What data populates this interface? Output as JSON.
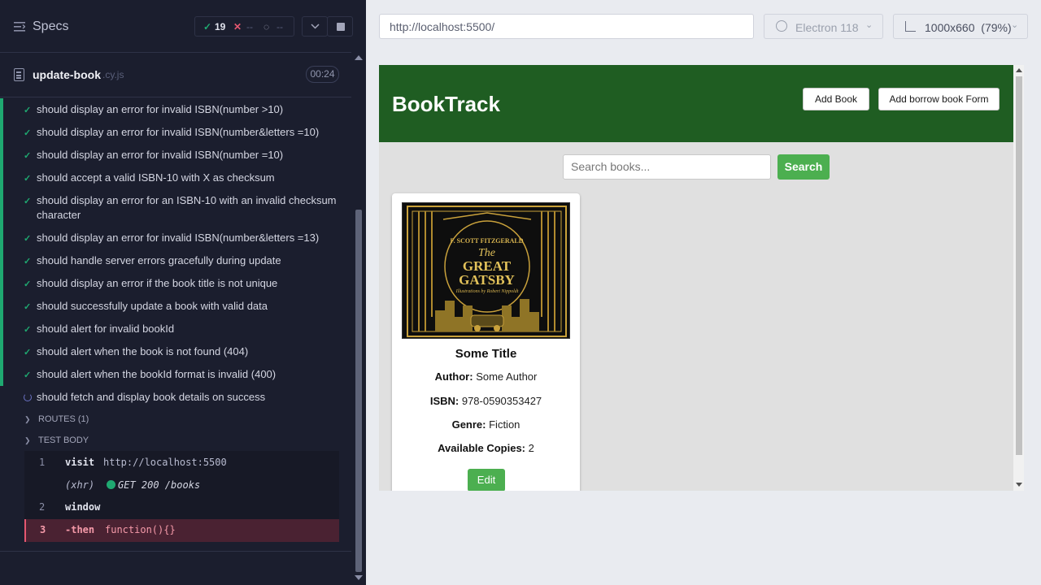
{
  "runner": {
    "specs_label": "Specs",
    "stats": {
      "passed": "19",
      "failed": "--",
      "pending": "--"
    },
    "spec": {
      "name": "update-book",
      "ext": ".cy.js",
      "duration": "00:24"
    },
    "tests": [
      "should display an error for invalid ISBN(number >10)",
      "should display an error for invalid ISBN(number&letters =10)",
      "should display an error for invalid ISBN(number =10)",
      "should accept a valid ISBN-10 with X as checksum",
      "should display an error for an ISBN-10 with an invalid checksum character",
      "should display an error for invalid ISBN(number&letters =13)",
      "should handle server errors gracefully during update",
      "should display an error if the book title is not unique",
      "should successfully update a book with valid data",
      "should alert for invalid bookId",
      "should alert when the book is not found (404)",
      "should alert when the bookId format is invalid (400)"
    ],
    "running_test": "should fetch and display book details on success",
    "routes_label": "ROUTES (1)",
    "body_label": "TEST BODY",
    "commands": {
      "c1": {
        "num": "1",
        "name": "visit",
        "msg": "http://localhost:5500"
      },
      "xhr": {
        "tag": "(xhr)",
        "msg": "GET 200 /books"
      },
      "c2": {
        "num": "2",
        "name": "window"
      },
      "c3": {
        "num": "3",
        "name": "-then",
        "msg": "function(){}"
      }
    },
    "colors": {
      "pass": "#1fa971",
      "fail": "#e45770",
      "bg": "#1b1e2e"
    }
  },
  "browser": {
    "url": "http://localhost:5500/",
    "engine": "Electron 118",
    "viewport": "1000x660",
    "zoom": "(79%)"
  },
  "app": {
    "title": "BookTrack",
    "add_book": "Add Book",
    "add_borrow": "Add borrow book Form",
    "search_placeholder": "Search books...",
    "search_button": "Search",
    "book": {
      "cover_author": "F. SCOTT FITZGERALD",
      "cover_title_1": "The",
      "cover_title_2": "GREAT",
      "cover_title_3": "GATSBY",
      "cover_illus": "Illustrations by Robert Nippoldt",
      "title": "Some Title",
      "author_label": "Author:",
      "author": "Some Author",
      "isbn_label": "ISBN:",
      "isbn": "978-0590353427",
      "genre_label": "Genre:",
      "genre": "Fiction",
      "copies_label": "Available Copies:",
      "copies": "2",
      "edit": "Edit"
    },
    "colors": {
      "header": "#1f5d22",
      "button": "#4caf50"
    }
  }
}
